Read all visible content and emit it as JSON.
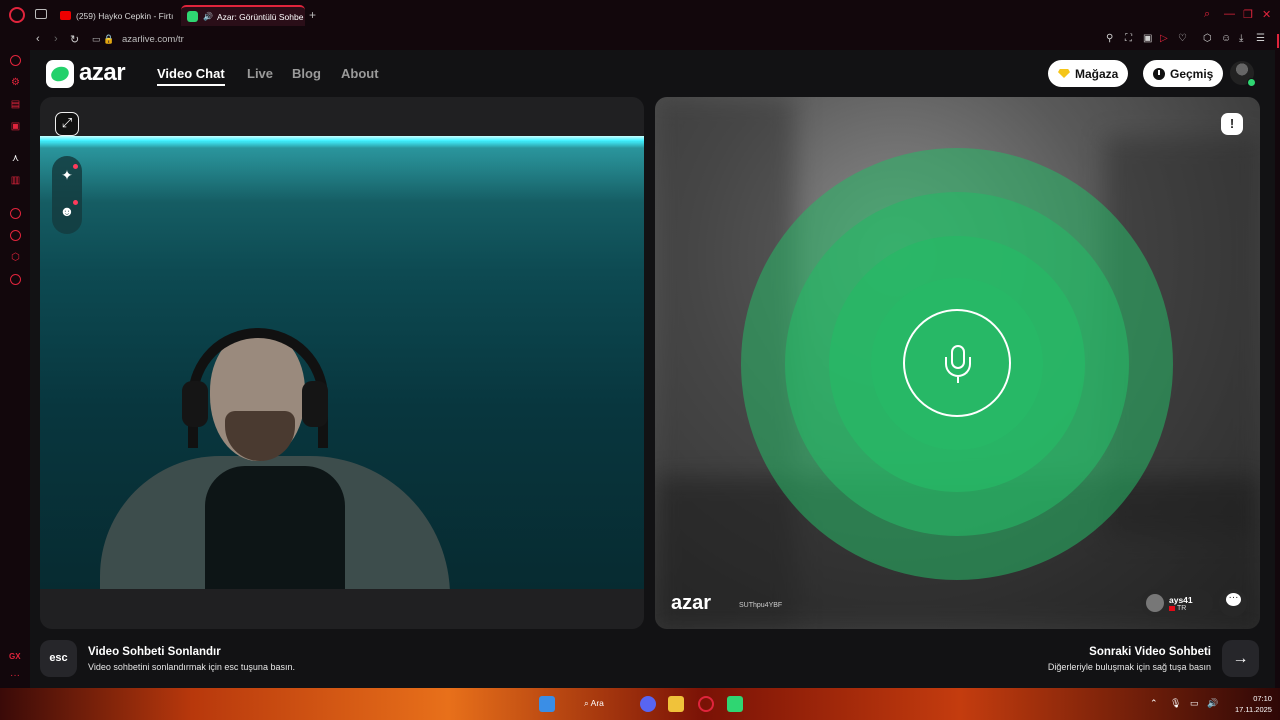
{
  "browser": {
    "tabs": [
      {
        "title": "(259) Hayko Cepkin - Firtı",
        "favicon": "youtube-icon"
      },
      {
        "title": "Azar: Görüntülü Sohbe",
        "favicon": "azar-icon",
        "audio": true
      }
    ],
    "url": "azarlive.com/tr"
  },
  "header": {
    "logo_text": "azar",
    "nav": [
      "Video Chat",
      "Live",
      "Blog",
      "About"
    ],
    "store_label": "Mağaza",
    "history_label": "Geçmiş"
  },
  "right_panel": {
    "watermark_logo": "azar",
    "watermark_code": "SUThpu4YBF",
    "user": {
      "name": "ays41",
      "country": "TR"
    }
  },
  "footer": {
    "esc_key": "esc",
    "end_title": "Video Sohbeti Sonlandır",
    "end_sub": "Video sohbetini sonlandırmak için esc tuşuna basın.",
    "next_title": "Sonraki Video Sohbeti",
    "next_sub": "Diğerleriyle buluşmak için sağ tuşa basın"
  },
  "taskbar": {
    "search_label": "Ara",
    "time": "07:10",
    "date": "17.11.2025"
  },
  "sidebar": {
    "gx_label": "GX"
  },
  "colors": {
    "accent_green": "#27b866",
    "opera_red": "#e0243c",
    "led_cyan": "#3ff0ff"
  }
}
